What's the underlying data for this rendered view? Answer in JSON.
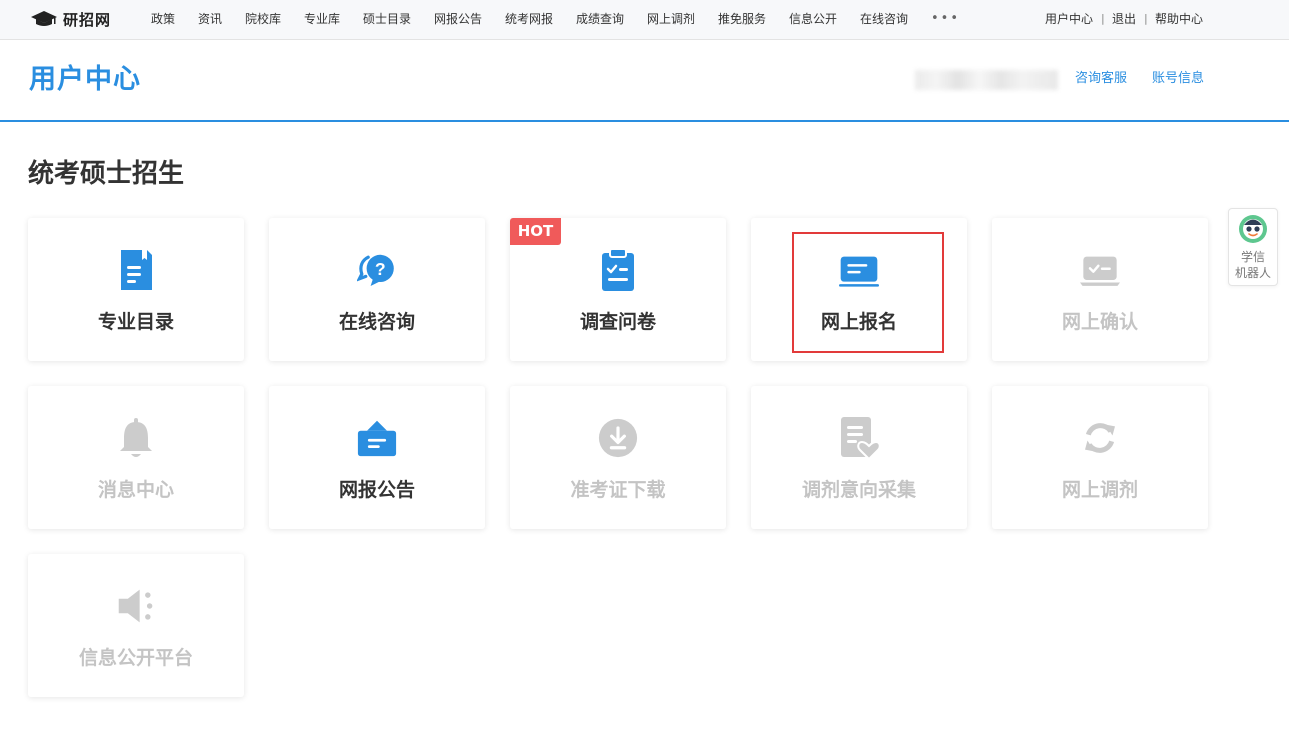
{
  "brand": {
    "logo_text": "研招网"
  },
  "nav": {
    "items": [
      "政策",
      "资讯",
      "院校库",
      "专业库",
      "硕士目录",
      "网报公告",
      "统考网报",
      "成绩查询",
      "网上调剂",
      "推免服务",
      "信息公开",
      "在线咨询"
    ],
    "more": "•••",
    "right_links": [
      "用户中心",
      "退出",
      "帮助中心"
    ],
    "separator": "|"
  },
  "header": {
    "title": "用户中心",
    "links": [
      "咨询客服",
      "账号信息"
    ]
  },
  "section": {
    "title": "统考硕士招生"
  },
  "cards": [
    {
      "label": "专业目录",
      "icon": "document-icon",
      "enabled": true,
      "badge": ""
    },
    {
      "label": "在线咨询",
      "icon": "chat-question-icon",
      "enabled": true,
      "badge": ""
    },
    {
      "label": "调查问卷",
      "icon": "clipboard-check-icon",
      "enabled": true,
      "badge": "HOT"
    },
    {
      "label": "网上报名",
      "icon": "form-screen-icon",
      "enabled": true,
      "badge": "",
      "highlighted": true
    },
    {
      "label": "网上确认",
      "icon": "laptop-check-icon",
      "enabled": false,
      "badge": ""
    },
    {
      "label": "消息中心",
      "icon": "bell-icon",
      "enabled": false,
      "badge": ""
    },
    {
      "label": "网报公告",
      "icon": "notice-board-icon",
      "enabled": true,
      "badge": ""
    },
    {
      "label": "准考证下载",
      "icon": "download-icon",
      "enabled": false,
      "badge": ""
    },
    {
      "label": "调剂意向采集",
      "icon": "doc-heart-icon",
      "enabled": false,
      "badge": ""
    },
    {
      "label": "网上调剂",
      "icon": "refresh-icon",
      "enabled": false,
      "badge": ""
    },
    {
      "label": "信息公开平台",
      "icon": "speaker-icon",
      "enabled": false,
      "badge": ""
    }
  ],
  "robot": {
    "line1": "学信",
    "line2": "机器人"
  },
  "colors": {
    "accent": "#2a8ee0",
    "hot_badge": "#f05a5a",
    "highlight_border": "#e23a3a",
    "disabled": "#c4c4c4",
    "icon_blue": "#2a8ee0",
    "icon_disabled": "#cccccc"
  }
}
